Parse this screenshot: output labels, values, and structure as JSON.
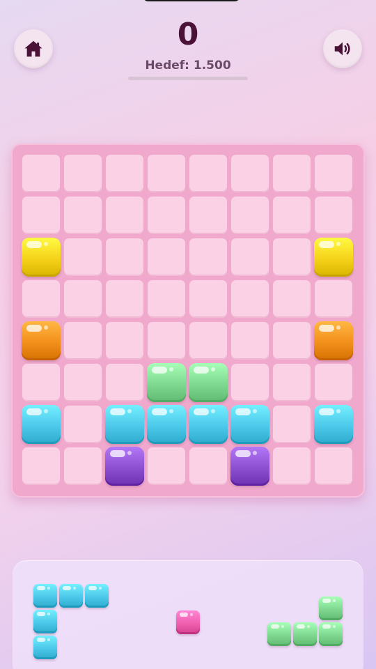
{
  "header": {
    "score": "0",
    "target_label": "Hedef: 1.500",
    "progress_fraction": 0.0
  },
  "buttons": {
    "home_icon": "home-icon",
    "sound_icon": "speaker-icon"
  },
  "colors": {
    "yellow": "#f6d21a",
    "orange": "#f38f1b",
    "green": "#7fd88f",
    "blue": "#4cc8ea",
    "purple": "#8b4fd0",
    "pink": "#ef5fae",
    "cell": "#fbd2e5",
    "board": "#f0a9cc"
  },
  "board": {
    "rows": 8,
    "cols": 8,
    "grid": [
      [
        "",
        "",
        "",
        "",
        "",
        "",
        "",
        ""
      ],
      [
        "",
        "",
        "",
        "",
        "",
        "",
        "",
        ""
      ],
      [
        "yellow",
        "",
        "",
        "",
        "",
        "",
        "",
        "yellow"
      ],
      [
        "",
        "",
        "",
        "",
        "",
        "",
        "",
        ""
      ],
      [
        "orange",
        "",
        "",
        "",
        "",
        "",
        "",
        "orange"
      ],
      [
        "",
        "",
        "",
        "green",
        "green",
        "",
        "",
        ""
      ],
      [
        "blue",
        "",
        "blue",
        "blue",
        "blue",
        "blue",
        "",
        "blue"
      ],
      [
        "",
        "",
        "purple",
        "",
        "",
        "purple",
        "",
        ""
      ]
    ]
  },
  "pieces": [
    {
      "name": "piece-blue-corner",
      "color": "blue",
      "cells": [
        [
          0,
          0
        ],
        [
          0,
          1
        ],
        [
          0,
          2
        ],
        [
          1,
          0
        ],
        [
          2,
          0
        ]
      ]
    },
    {
      "name": "piece-pink-single",
      "color": "pink",
      "cells": [
        [
          0,
          0
        ]
      ]
    },
    {
      "name": "piece-green-l",
      "color": "green",
      "cells": [
        [
          0,
          2
        ],
        [
          1,
          0
        ],
        [
          1,
          1
        ],
        [
          1,
          2
        ]
      ]
    }
  ]
}
